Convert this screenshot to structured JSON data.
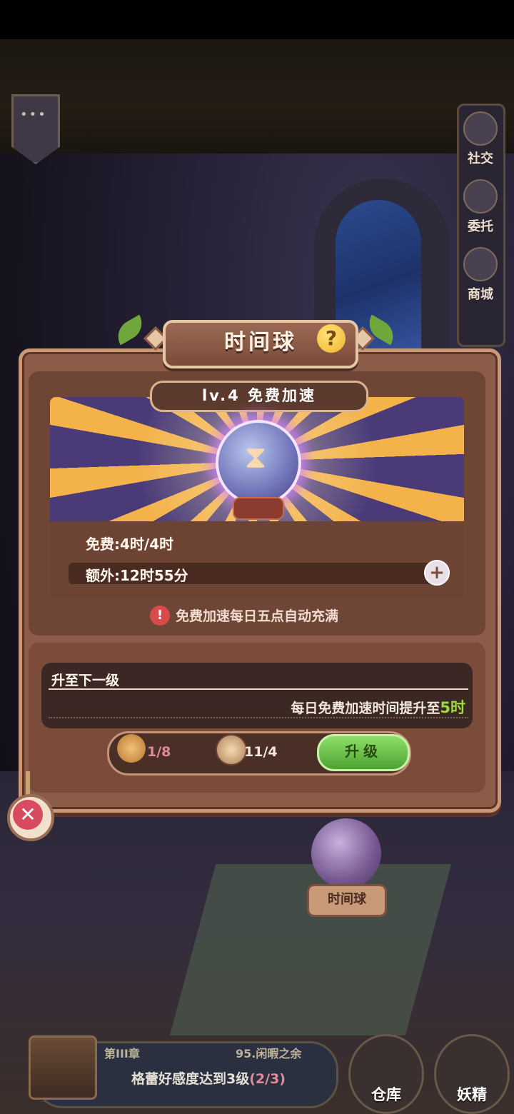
{
  "side_menu": {
    "items": [
      {
        "label": "社交"
      },
      {
        "label": "委托"
      },
      {
        "label": "商城"
      }
    ]
  },
  "dialog": {
    "title": "时间球",
    "level_label": "lv.4  免费加速",
    "stats": {
      "free": "免费:4时/4时",
      "extra": "额外:12时55分"
    },
    "notice": "免费加速每日五点自动充满",
    "next_level": {
      "title": "升至下一级",
      "desc_prefix": "每日免费加速时间提升至",
      "desc_value": "5时"
    },
    "costs": [
      {
        "icon": "gears-icon",
        "value": "1/8",
        "color": "#e08a9b"
      },
      {
        "icon": "hourglass-coin-icon",
        "value": "11/4",
        "color": "#f3e7dc"
      }
    ],
    "upgrade_label": "升级"
  },
  "world": {
    "plaque": "时间球"
  },
  "quest": {
    "chapter": "第III章",
    "episode": "95.闲暇之余",
    "text": "格蕾好感度达到3级",
    "progress": "(2/3)"
  },
  "bottom_buttons": [
    {
      "label": "仓库"
    },
    {
      "label": "妖精"
    }
  ],
  "colors": {
    "accent_green": "#9bdb3d",
    "panel_brown": "#8d5c49",
    "close_red": "#d84a62"
  }
}
